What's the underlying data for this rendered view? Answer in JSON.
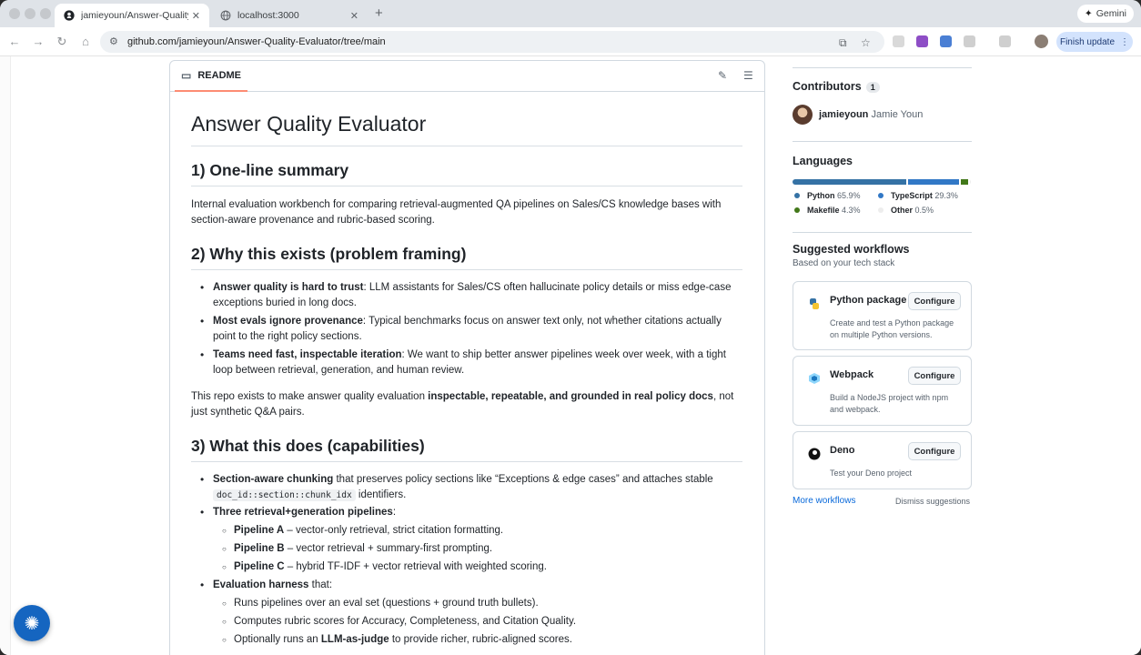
{
  "browser": {
    "tabs": [
      {
        "title": "jamieyoun/Answer-Quality-E…",
        "close": "✕"
      },
      {
        "title": "localhost:3000",
        "close": "✕"
      }
    ],
    "new_tab": "+",
    "gemini_label": "Gemini",
    "url": "github.com/jamieyoun/Answer-Quality-Evaluator/tree/main",
    "finish_update_label": "Finish update",
    "finish_update_menu": "⋮"
  },
  "readme": {
    "tab_label": "README",
    "title": "Answer Quality Evaluator",
    "s1": {
      "heading": "1) One-line summary",
      "body": "Internal evaluation workbench for comparing retrieval-augmented QA pipelines on Sales/CS knowledge bases with section-aware provenance and rubric-based scoring."
    },
    "s2": {
      "heading": "2) Why this exists (problem framing)",
      "bullets": [
        {
          "bold": "Answer quality is hard to trust",
          "text": ": LLM assistants for Sales/CS often hallucinate policy details or miss edge-case exceptions buried in long docs."
        },
        {
          "bold": "Most evals ignore provenance",
          "text": ": Typical benchmarks focus on answer text only, not whether citations actually point to the right policy sections."
        },
        {
          "bold": "Teams need fast, inspectable iteration",
          "text": ": We want to ship better answer pipelines week over week, with a tight loop between retrieval, generation, and human review."
        }
      ],
      "closing_pre": "This repo exists to make answer quality evaluation ",
      "closing_bold": "inspectable, repeatable, and grounded in real policy docs",
      "closing_post": ", not just synthetic Q&A pairs."
    },
    "s3": {
      "heading": "3) What this does (capabilities)",
      "chunking_bold": "Section-aware chunking",
      "chunking_text": " that preserves policy sections like “Exceptions & edge cases” and attaches stable",
      "chunking_code": "doc_id::section::chunk_idx",
      "chunking_tail": " identifiers.",
      "pipelines_bold": "Three retrieval+generation pipelines",
      "pipelines_tail": ":",
      "pipelines": [
        {
          "bold": "Pipeline A",
          "text": " – vector-only retrieval, strict citation formatting."
        },
        {
          "bold": "Pipeline B",
          "text": " – vector retrieval + summary-first prompting."
        },
        {
          "bold": "Pipeline C",
          "text": " – hybrid TF-IDF + vector retrieval with weighted scoring."
        }
      ],
      "harness_bold": "Evaluation harness",
      "harness_tail": " that:",
      "harness": [
        {
          "pre": "Runs pipelines over an eval set (questions + ground truth bullets).",
          "bold": "",
          "post": ""
        },
        {
          "pre": "Computes rubric scores for Accuracy, Completeness, and Citation Quality.",
          "bold": "",
          "post": ""
        },
        {
          "pre": "Optionally runs an ",
          "bold": "LLM-as-judge",
          "post": " to provide richer, rubric-aligned scores."
        }
      ]
    }
  },
  "sidebar": {
    "contributors": {
      "heading": "Contributors",
      "count": "1",
      "login": "jamieyoun",
      "name": "Jamie Youn"
    },
    "languages": {
      "heading": "Languages",
      "items": [
        {
          "name": "Python",
          "percent": "65.9%",
          "value": 65.9,
          "color": "#3572A5"
        },
        {
          "name": "TypeScript",
          "percent": "29.3%",
          "value": 29.3,
          "color": "#3178c6"
        },
        {
          "name": "Makefile",
          "percent": "4.3%",
          "value": 4.3,
          "color": "#427819"
        },
        {
          "name": "Other",
          "percent": "0.5%",
          "value": 0.5,
          "color": "#ededed"
        }
      ]
    },
    "workflows": {
      "heading": "Suggested workflows",
      "subheading": "Based on your tech stack",
      "configure_label": "Configure",
      "cards": [
        {
          "name": "Python package",
          "desc": "Create and test a Python package on multiple Python versions.",
          "icon": "python-icon"
        },
        {
          "name": "Webpack",
          "desc": "Build a NodeJS project with npm and webpack.",
          "icon": "webpack-icon"
        },
        {
          "name": "Deno",
          "desc": "Test your Deno project",
          "icon": "deno-icon"
        }
      ],
      "more_label": "More workflows",
      "dismiss_label": "Dismiss suggestions"
    }
  }
}
